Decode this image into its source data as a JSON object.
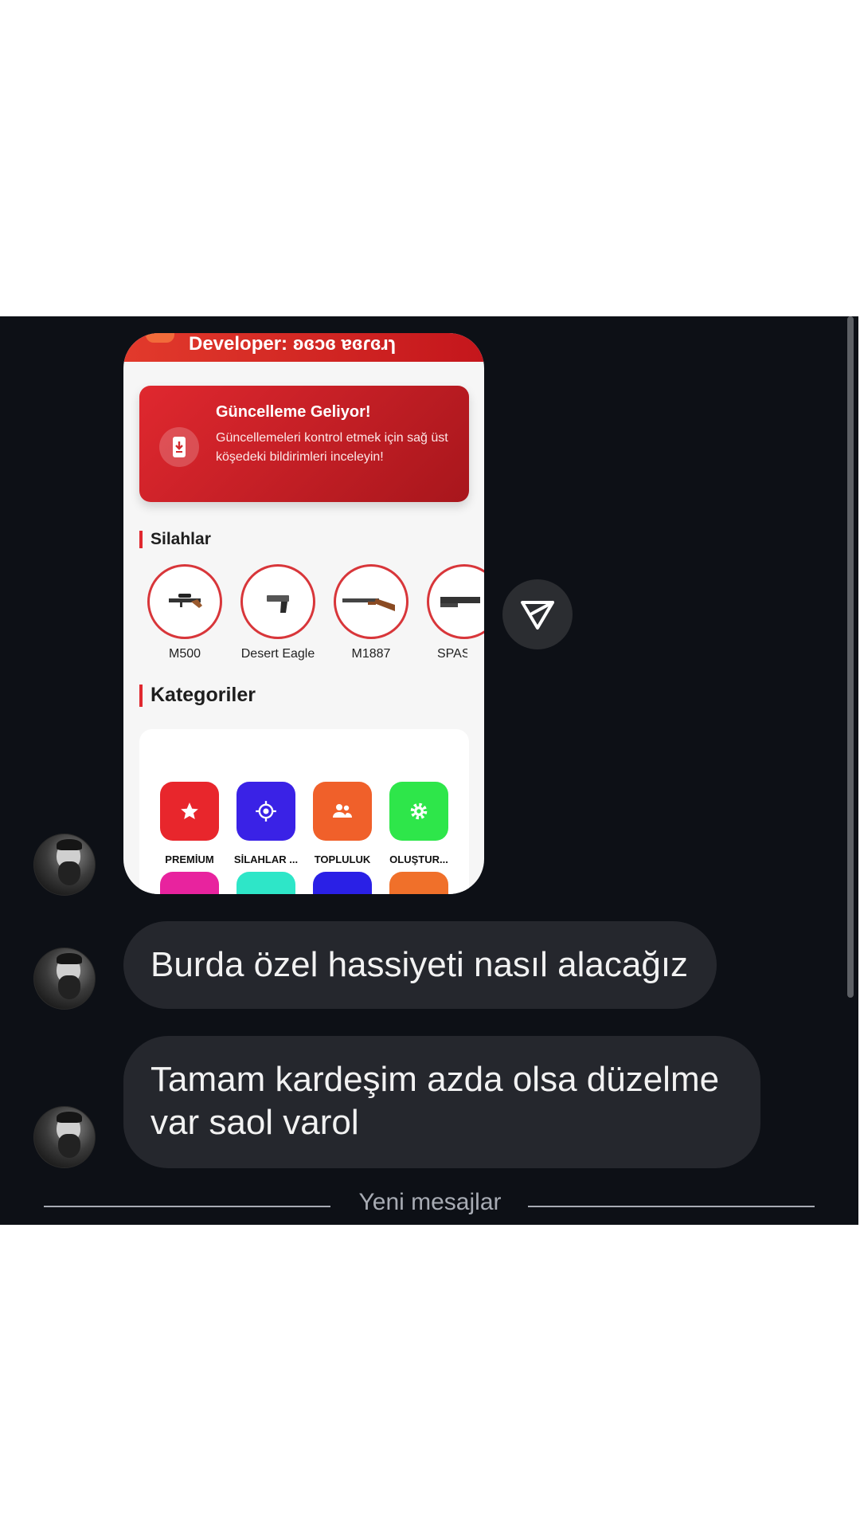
{
  "phone": {
    "developer_label": "Developer: ʚɞɔɞ ɐɞɾɞɹɿ",
    "banner": {
      "title": "Güncelleme Geliyor!",
      "text": "Güncellemeleri kontrol etmek için sağ üst köşedeki bildirimleri inceleyin!"
    },
    "weapons_title": "Silahlar",
    "weapons": [
      {
        "name": "M500"
      },
      {
        "name": "Desert Eagle"
      },
      {
        "name": "M1887"
      },
      {
        "name": "SPAS"
      }
    ],
    "categories_title": "Kategoriler",
    "categories": [
      {
        "label": "PREMİUM",
        "color": "#e8262c",
        "icon": "star-icon"
      },
      {
        "label": "SİLAHLAR ...",
        "color": "#3a22e6",
        "icon": "target-icon"
      },
      {
        "label": "TOPLULUK",
        "color": "#f0602a",
        "icon": "people-icon"
      },
      {
        "label": "OLUŞTUR...",
        "color": "#2ee64a",
        "icon": "gear-icon"
      }
    ],
    "categories_row2_colors": [
      "#e8239e",
      "#2ee6c8",
      "#2a20e6",
      "#f0702a"
    ]
  },
  "messages": [
    {
      "text": "Burda özel hassiyeti nasıl alacağız"
    },
    {
      "line1": "Tamam kardeşim azda olsa düzelme",
      "line2": "var saol varol"
    }
  ],
  "divider": {
    "text": "Yeni mesajlar"
  },
  "colors": {
    "chat_bg": "#0d1016",
    "bubble_bg": "#25272d",
    "accent_red": "#e0282f"
  }
}
